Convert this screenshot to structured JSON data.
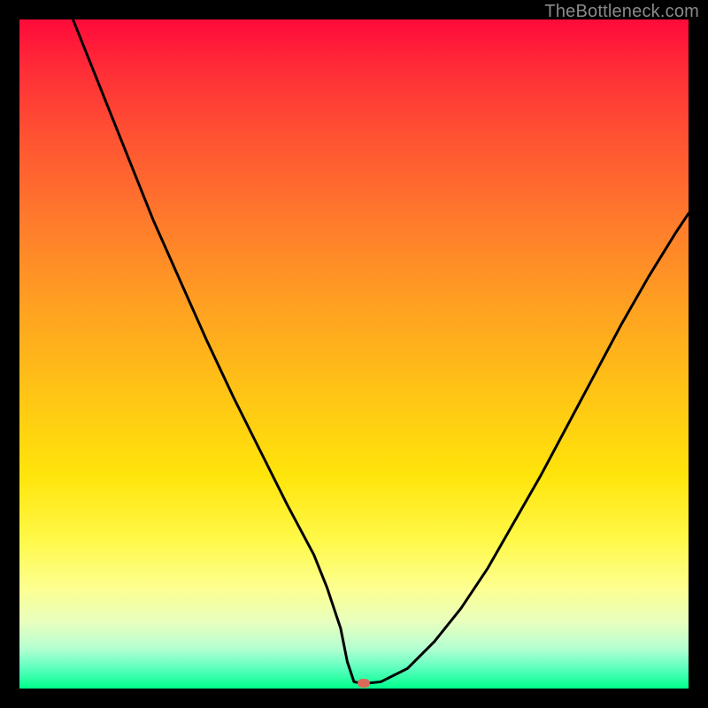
{
  "watermark": "TheBottleneck.com",
  "chart_data": {
    "type": "line",
    "title": "",
    "xlabel": "",
    "ylabel": "",
    "xlim": [
      0,
      100
    ],
    "ylim": [
      0,
      100
    ],
    "grid": false,
    "legend": false,
    "series": [
      {
        "name": "bottleneck-curve",
        "x": [
          8,
          12,
          16,
          20,
          24,
          28,
          32,
          36,
          40,
          44,
          46,
          48,
          49,
          50,
          51,
          52,
          54,
          58,
          62,
          66,
          70,
          74,
          78,
          82,
          86,
          90,
          94,
          98,
          100
        ],
        "values": [
          100,
          90,
          80,
          70,
          61,
          52,
          43.5,
          35.5,
          27.5,
          20,
          15,
          9,
          4,
          1,
          0.8,
          0.8,
          1,
          3,
          7,
          12,
          18,
          25,
          32,
          39.5,
          47,
          54.5,
          61.5,
          68,
          71
        ]
      }
    ],
    "optimum_marker": {
      "x": 51.5,
      "y": 0.8,
      "color": "#d96a5a"
    },
    "gradient_stops": [
      {
        "pct": 0,
        "color": "#ff0a3a"
      },
      {
        "pct": 8,
        "color": "#ff2f37"
      },
      {
        "pct": 18,
        "color": "#ff5432"
      },
      {
        "pct": 30,
        "color": "#ff7a2c"
      },
      {
        "pct": 42,
        "color": "#ff9e22"
      },
      {
        "pct": 55,
        "color": "#ffc216"
      },
      {
        "pct": 68,
        "color": "#ffe40a"
      },
      {
        "pct": 78,
        "color": "#fff94a"
      },
      {
        "pct": 85,
        "color": "#fdff90"
      },
      {
        "pct": 90,
        "color": "#e8ffbe"
      },
      {
        "pct": 94,
        "color": "#b5ffd1"
      },
      {
        "pct": 97,
        "color": "#5cffbf"
      },
      {
        "pct": 100,
        "color": "#00ff8b"
      }
    ]
  }
}
